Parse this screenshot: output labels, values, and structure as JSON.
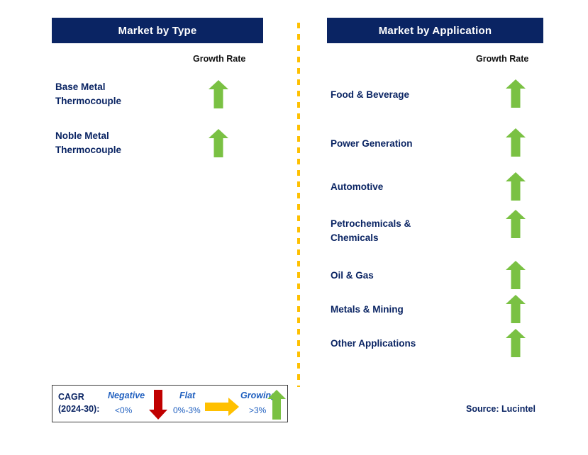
{
  "columns": {
    "type": {
      "header": "Market by Type",
      "growth_caption": "Growth Rate",
      "rows": [
        {
          "label": "Base Metal\nThermocouple",
          "growth": "growing",
          "arrow_icon": "arrow-up-icon"
        },
        {
          "label": "Noble Metal\nThermocouple",
          "growth": "growing",
          "arrow_icon": "arrow-up-icon"
        }
      ]
    },
    "application": {
      "header": "Market by Application",
      "growth_caption": "Growth Rate",
      "rows": [
        {
          "label": "Food & Beverage",
          "growth": "growing",
          "arrow_icon": "arrow-up-icon"
        },
        {
          "label": "Power Generation",
          "growth": "growing",
          "arrow_icon": "arrow-up-icon"
        },
        {
          "label": "Automotive",
          "growth": "growing",
          "arrow_icon": "arrow-up-icon"
        },
        {
          "label": "Petrochemicals &\nChemicals",
          "growth": "growing",
          "arrow_icon": "arrow-up-icon"
        },
        {
          "label": "Oil & Gas",
          "growth": "growing",
          "arrow_icon": "arrow-up-icon"
        },
        {
          "label": "Metals & Mining",
          "growth": "growing",
          "arrow_icon": "arrow-up-icon"
        },
        {
          "label": "Other Applications",
          "growth": "growing",
          "arrow_icon": "arrow-up-icon"
        }
      ]
    }
  },
  "legend": {
    "title_line1": "CAGR",
    "title_line2": "(2024-30):",
    "items": [
      {
        "word": "Negative",
        "range": "<0%",
        "icon": "arrow-down-icon",
        "color": "#C00000"
      },
      {
        "word": "Flat",
        "range": "0%-3%",
        "icon": "arrow-right-icon",
        "color": "#FFC000"
      },
      {
        "word": "Growing",
        "range": ">3%",
        "icon": "arrow-up-icon",
        "color": "#7AC143"
      }
    ]
  },
  "source": "Source: Lucintel",
  "colors": {
    "header_navy": "#0A2463",
    "label_navy": "#0A2463",
    "growing_green": "#7AC143",
    "negative_red": "#C00000",
    "flat_amber": "#FFC000",
    "legend_blue": "#1F5FBF",
    "divider_amber": "#FFC000"
  }
}
